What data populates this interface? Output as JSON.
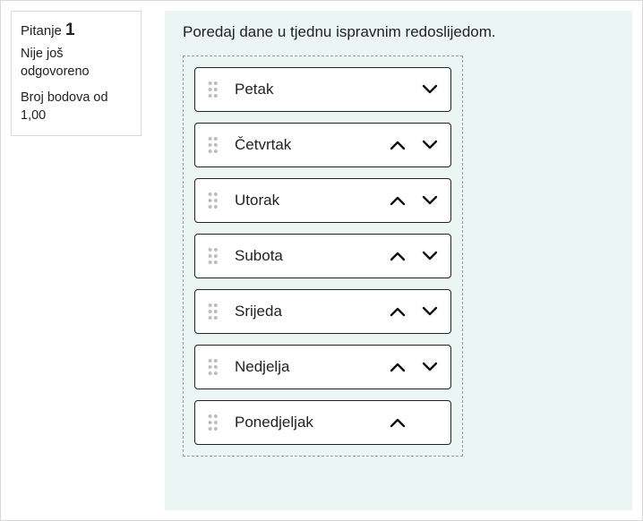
{
  "info": {
    "question_label": "Pitanje",
    "question_number": "1",
    "status": "Nije još odgovoreno",
    "marks": "Broj bodova od 1,00"
  },
  "question": {
    "text": "Poredaj dane u tjednu ispravnim redoslijedom.",
    "items": [
      {
        "label": "Petak"
      },
      {
        "label": "Četvrtak"
      },
      {
        "label": "Utorak"
      },
      {
        "label": "Subota"
      },
      {
        "label": "Srijeda"
      },
      {
        "label": "Nedjelja"
      },
      {
        "label": "Ponedjeljak"
      }
    ]
  }
}
